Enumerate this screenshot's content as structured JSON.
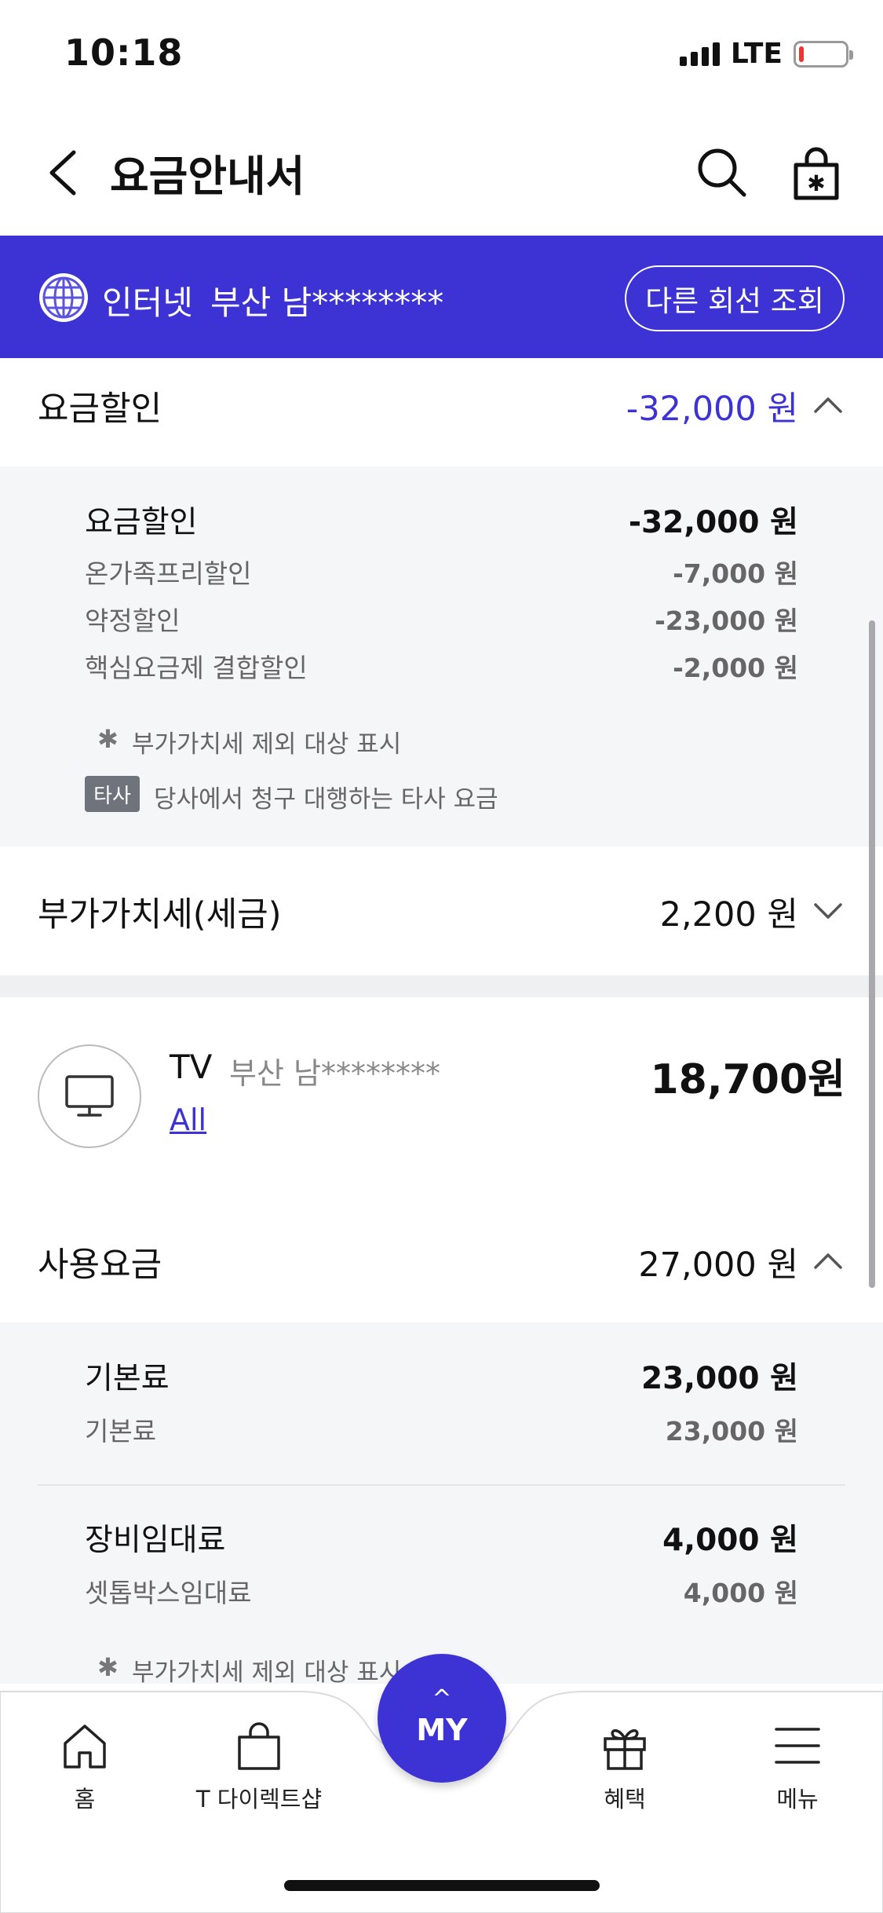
{
  "status_bar": {
    "time": "10:18",
    "network": "LTE"
  },
  "header": {
    "title": "요금안내서"
  },
  "line_banner": {
    "service": "인터넷",
    "region": "부산 남********",
    "other_line_button": "다른 회선 조회"
  },
  "discount_section": {
    "title": "요금할인",
    "amount": "-32,000 원",
    "details": {
      "main_label": "요금할인",
      "main_value": "-32,000 원",
      "items": [
        {
          "label": "온가족프리할인",
          "value": "-7,000 원"
        },
        {
          "label": "약정할인",
          "value": "-23,000 원"
        },
        {
          "label": "핵심요금제 결합할인",
          "value": "-2,000 원"
        }
      ],
      "note_vat": "부가가치세 제외 대상 표시",
      "note_star": "✱",
      "badge_label": "타사",
      "note_other": "당사에서 청구 대행하는 타사 요금"
    }
  },
  "vat_section": {
    "title": "부가가치세(세금)",
    "amount": "2,200 원"
  },
  "tv_card": {
    "name": "TV",
    "region": "부산 남********",
    "link": "All",
    "total": "18,700원"
  },
  "usage_section": {
    "title": "사용요금",
    "amount": "27,000 원",
    "groups": [
      {
        "main_label": "기본료",
        "main_value": "23,000 원",
        "sub_label": "기본료",
        "sub_value": "23,000 원"
      },
      {
        "main_label": "장비임대료",
        "main_value": "4,000 원",
        "sub_label": "셋톱박스임대료",
        "sub_value": "4,000 원"
      }
    ],
    "note_vat": "부가가치세 제외 대상 표시",
    "note_star": "✱"
  },
  "bottom_nav": {
    "items": [
      {
        "label": "홈",
        "icon": "home-icon"
      },
      {
        "label": "T 다이렉트샵",
        "icon": "shopping-bag-icon"
      },
      {
        "label": "혜택",
        "icon": "gift-icon"
      },
      {
        "label": "메뉴",
        "icon": "menu-icon"
      }
    ],
    "my_button": {
      "label": "MY",
      "arrow": "^"
    }
  },
  "colors": {
    "accent": "#3d33d4",
    "discount_text": "#3d33d4",
    "detail_bg": "#f5f6f8"
  }
}
